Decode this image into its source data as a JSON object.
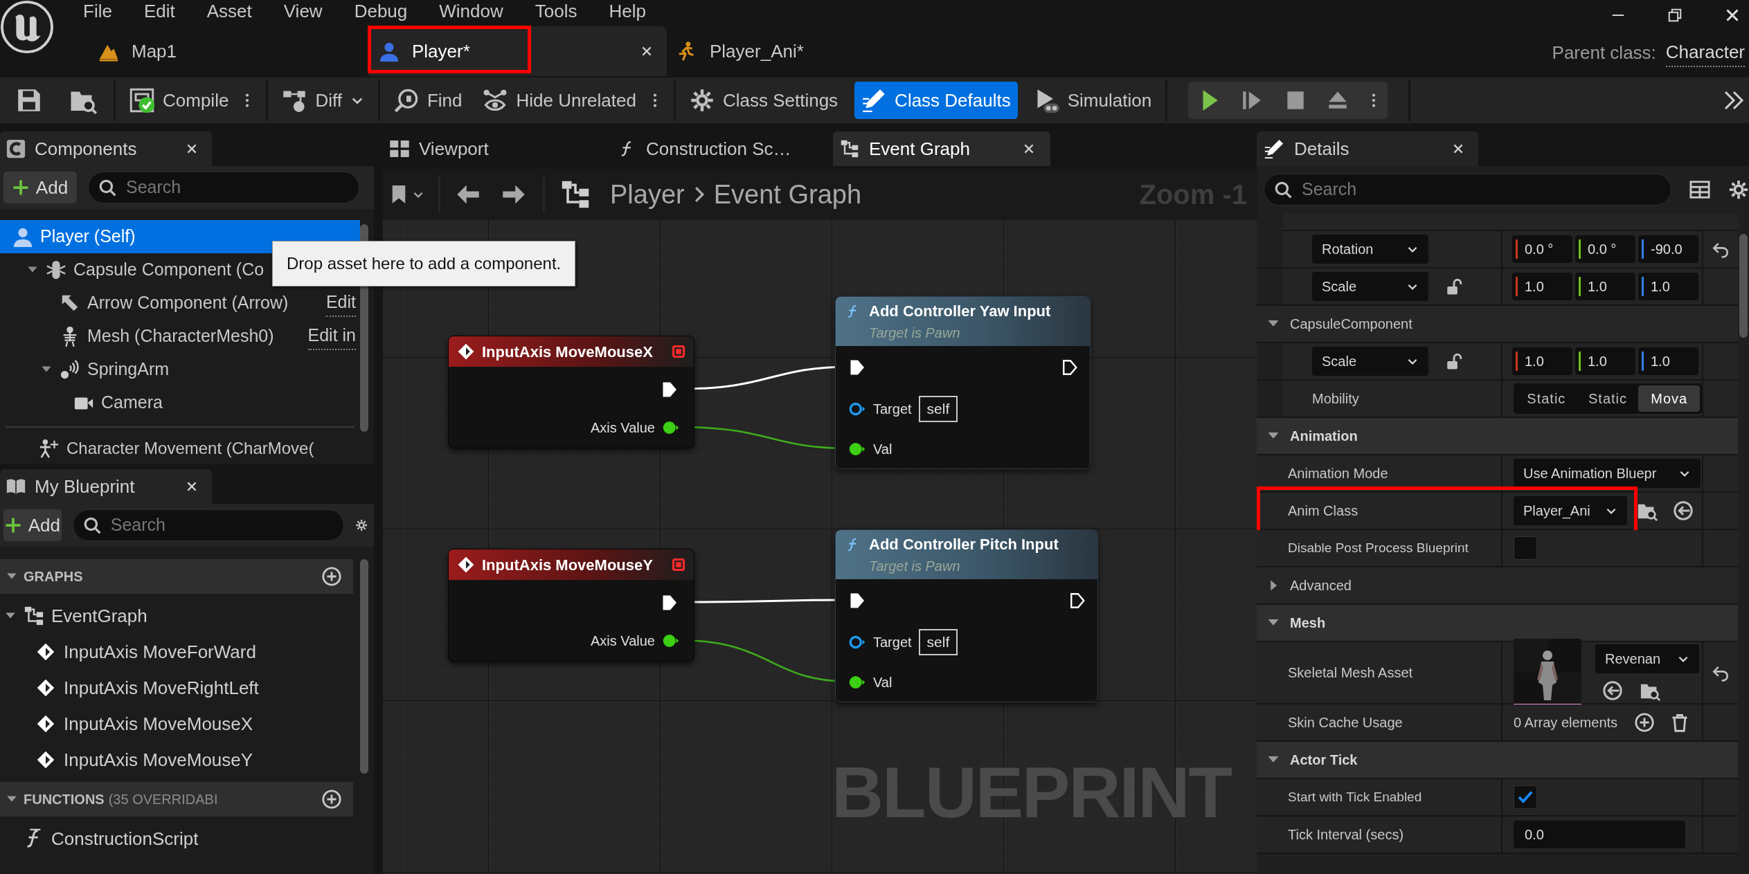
{
  "menu": [
    "File",
    "Edit",
    "Asset",
    "View",
    "Debug",
    "Window",
    "Tools",
    "Help"
  ],
  "document_tabs": [
    {
      "label": "Map1",
      "selected": false,
      "highlighted": false
    },
    {
      "label": "Player*",
      "selected": true,
      "highlighted": true
    },
    {
      "label": "Player_Ani*",
      "selected": false,
      "highlighted": false
    }
  ],
  "parent_class": {
    "label": "Parent class:",
    "value": "Character"
  },
  "toolbar": [
    {
      "label": "Compile",
      "selected": false
    },
    {
      "label": "Diff",
      "selected": false
    },
    {
      "label": "Find",
      "selected": false
    },
    {
      "label": "Hide Unrelated",
      "selected": false
    },
    {
      "label": "Class Settings",
      "selected": false
    },
    {
      "label": "Class Defaults",
      "selected": true
    },
    {
      "label": "Simulation",
      "selected": false
    }
  ],
  "components": {
    "title": "Components",
    "add": "Add",
    "search": {
      "placeholder": "Search"
    },
    "tree": [
      {
        "label": "Player (Self)",
        "selected": true,
        "children": [
          {
            "label": "Capsule Component (Co",
            "selected": false,
            "expanded": true,
            "children": [
              {
                "label": "Arrow Component (Arrow)",
                "link": "Edit",
                "selected": false
              },
              {
                "label": "Mesh (CharacterMesh0)",
                "link": "Edit in",
                "selected": false
              },
              {
                "label": "SpringArm",
                "selected": false,
                "expanded": true,
                "children": [
                  {
                    "label": "Camera",
                    "selected": false
                  }
                ]
              }
            ]
          }
        ]
      }
    ],
    "below": [
      {
        "label": "Character Movement (CharMove("
      }
    ]
  },
  "tooltip": "Drop asset here to add a component.",
  "my_blueprint": {
    "title": "My Blueprint",
    "add": "Add",
    "search": {
      "placeholder": "Search"
    },
    "sections": [
      {
        "title": "GRAPHS",
        "items": [
          {
            "label": "EventGraph",
            "expanded": true,
            "children": [
              {
                "label": "InputAxis MoveForWard"
              },
              {
                "label": "InputAxis MoveRightLeft"
              },
              {
                "label": "InputAxis MoveMouseX"
              },
              {
                "label": "InputAxis MoveMouseY"
              }
            ]
          }
        ]
      },
      {
        "title": "FUNCTIONS",
        "note": "(35 OVERRIDABI",
        "items": [
          {
            "label": "ConstructionScript"
          }
        ]
      }
    ]
  },
  "graph_tabs": [
    {
      "label": "Viewport",
      "selected": false
    },
    {
      "label": "Construction Sc…",
      "selected": false
    },
    {
      "label": "Event Graph",
      "selected": true
    }
  ],
  "breadcrumb": [
    "Player",
    "Event Graph"
  ],
  "zoom": "Zoom -1",
  "event_nodes": [
    {
      "title": "InputAxis MoveMouseX",
      "output": "Axis Value"
    },
    {
      "title": "InputAxis MoveMouseY",
      "output": "Axis Value"
    }
  ],
  "function_nodes": [
    {
      "title": "Add Controller Yaw Input",
      "subtitle": "Target is Pawn",
      "target_label": "Target",
      "target_value": "self",
      "input": "Val"
    },
    {
      "title": "Add Controller Pitch Input",
      "subtitle": "Target is Pawn",
      "target_label": "Target",
      "target_value": "self",
      "input": "Val"
    }
  ],
  "watermark": "BLUEPRINT",
  "details": {
    "title": "Details",
    "search": {
      "placeholder": "Search"
    },
    "rows": [
      {
        "kind": "transform",
        "label": "Rotation",
        "lock": false,
        "reset": true,
        "values": [
          "0.0 °",
          "0.0 °",
          "-90.0"
        ]
      },
      {
        "kind": "transform",
        "label": "Scale",
        "lock": true,
        "reset": false,
        "values": [
          "1.0",
          "1.0",
          "1.0"
        ]
      },
      {
        "kind": "subcategory",
        "label": "CapsuleComponent",
        "expanded": true
      },
      {
        "kind": "transform",
        "label": "Scale",
        "lock": true,
        "reset": false,
        "values": [
          "1.0",
          "1.0",
          "1.0"
        ]
      },
      {
        "kind": "segmented",
        "label": "Mobility",
        "options": [
          {
            "label": "Static",
            "selected": false
          },
          {
            "label": "Static",
            "selected": false
          },
          {
            "label": "Mova",
            "selected": true
          }
        ]
      },
      {
        "kind": "category",
        "label": "Animation",
        "expanded": true
      },
      {
        "kind": "dropdown",
        "label": "Animation Mode",
        "value": "Use Animation Bluepr"
      },
      {
        "kind": "class",
        "label": "Anim Class",
        "value": "Player_Ani",
        "highlighted": true
      },
      {
        "kind": "checkbox",
        "label": "Disable Post Process Blueprint",
        "checked": false
      },
      {
        "kind": "expander",
        "label": "Advanced",
        "expanded": false
      },
      {
        "kind": "category",
        "label": "Mesh",
        "expanded": true
      },
      {
        "kind": "asset",
        "label": "Skeletal Mesh Asset",
        "value": "Revenan"
      },
      {
        "kind": "array",
        "label": "Skin Cache Usage",
        "value": "0 Array elements"
      },
      {
        "kind": "category",
        "label": "Actor Tick",
        "expanded": true
      },
      {
        "kind": "checkbox",
        "label": "Start with Tick Enabled",
        "checked": true
      },
      {
        "kind": "number",
        "label": "Tick Interval (secs)",
        "value": "0.0"
      }
    ]
  }
}
